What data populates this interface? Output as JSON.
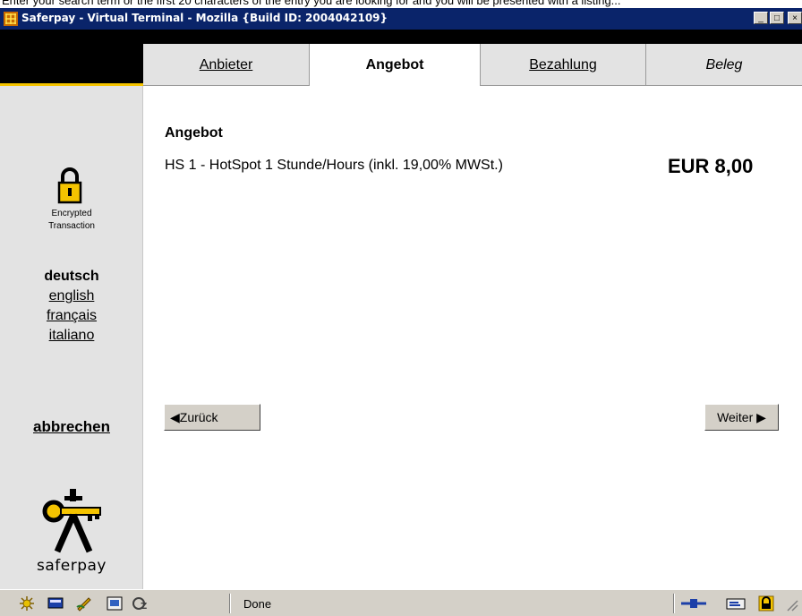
{
  "window": {
    "partial_top_text": "Enter your search term or the first 20 characters of the entry you are looking for and you will be presented with a listing...",
    "title": "Saferpay - Virtual Terminal - Mozilla {Build ID: 2004042109}",
    "minimize": "_",
    "maximize": "□",
    "close": "×"
  },
  "tabs": [
    {
      "label": "Anbieter"
    },
    {
      "label": "Angebot"
    },
    {
      "label": "Bezahlung"
    },
    {
      "label": "Beleg"
    }
  ],
  "sidebar": {
    "lock_caption_line1": "Encrypted",
    "lock_caption_line2": "Transaction",
    "languages": [
      "deutsch",
      "english",
      "français",
      "italiano"
    ],
    "cancel": "abbrechen",
    "brand": "saferpay"
  },
  "main": {
    "heading": "Angebot",
    "item": "HS 1 - HotSpot 1 Stunde/Hours (inkl. 19,00% MWSt.)",
    "price": "EUR 8,00",
    "back_button": "◀Zurück",
    "next_button": "Weiter ▶"
  },
  "statusbar": {
    "status": "Done"
  },
  "colors": {
    "accent": "#f5c400",
    "titlebar": "#0a246a",
    "sidebar": "#e3e3e3"
  }
}
